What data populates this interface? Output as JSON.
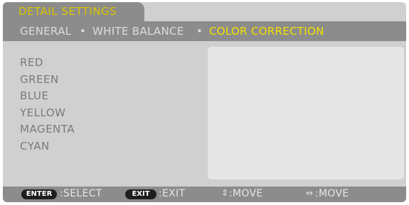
{
  "title": "DETAIL SETTINGS",
  "breadcrumb": {
    "general": "GENERAL",
    "white_balance": "WHITE BALANCE",
    "color_correction": "COLOR CORRECTION",
    "separator": "•"
  },
  "colors": {
    "panel_bg": "#d0d0d0",
    "bar_bg": "#8c8c8c",
    "active_text": "#f4e100",
    "title_text": "#d9c400",
    "item_text": "#7a7a7a",
    "preview_bg": "#e6e6e6"
  },
  "menu_items": [
    "RED",
    "GREEN",
    "BLUE",
    "YELLOW",
    "MAGENTA",
    "CYAN"
  ],
  "footer": {
    "enter_key": "ENTER",
    "select_label": ":SELECT",
    "exit_key": "EXIT",
    "exit_label": ":EXIT",
    "move_vertical_label": ":MOVE",
    "move_horizontal_label": ":MOVE",
    "updown_icon": "updown-arrow-icon",
    "leftright_icon": "leftright-arrow-icon"
  }
}
